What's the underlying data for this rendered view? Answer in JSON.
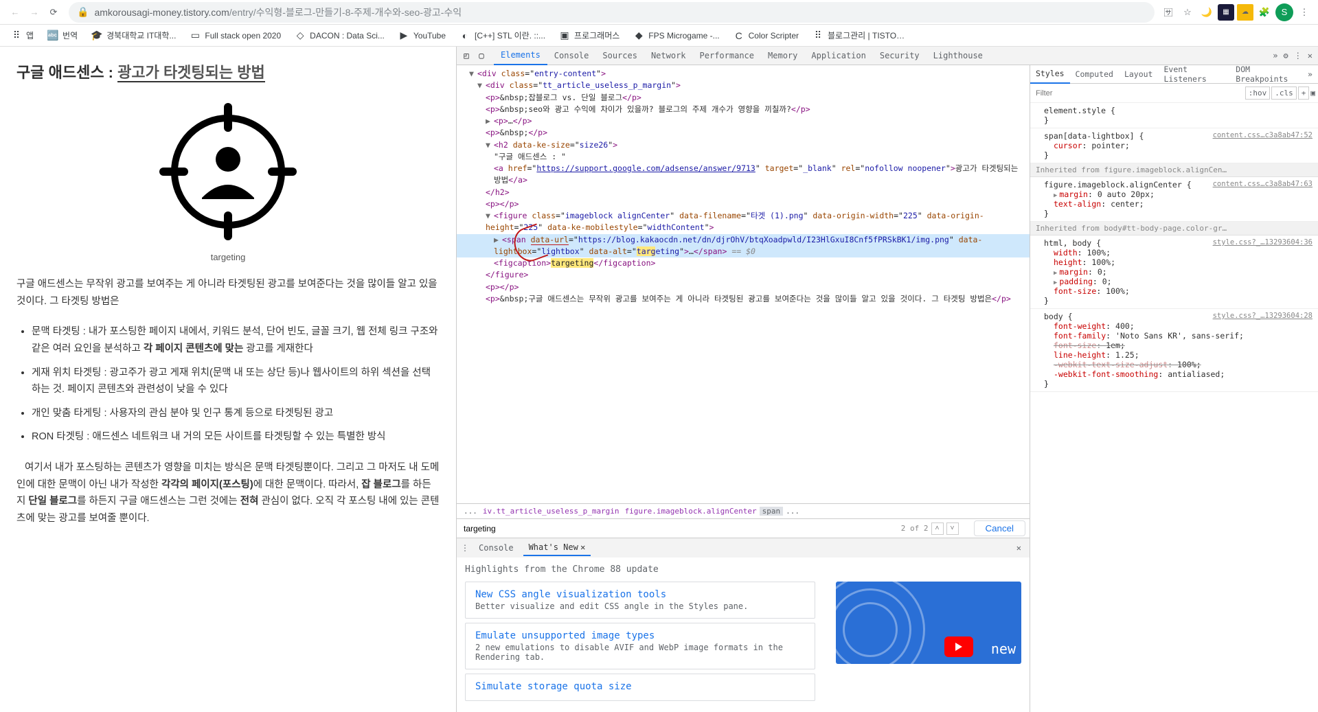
{
  "browser": {
    "url_domain": "amkorousagi-money.tistory.com",
    "url_path": "/entry/수익형-블로그-만들기-8-주제-개수와-seo-광고-수익",
    "actions": {
      "translate": "번역",
      "star": "즐겨찾기"
    },
    "avatar_letter": "S"
  },
  "bookmarks": [
    {
      "label": "앱",
      "icon": "⠿"
    },
    {
      "label": "번역",
      "icon": "🔤"
    },
    {
      "label": "경북대학교 IT대학...",
      "icon": "🎓"
    },
    {
      "label": "Full stack open 2020",
      "icon": "▭"
    },
    {
      "label": "DACON : Data Sci...",
      "icon": "◇"
    },
    {
      "label": "YouTube",
      "icon": "▶"
    },
    {
      "label": "[C++] STL 이란. ::...",
      "icon": "◐"
    },
    {
      "label": "프로그래머스",
      "icon": "▣"
    },
    {
      "label": "FPS Microgame -...",
      "icon": "◆"
    },
    {
      "label": "Color Scripter",
      "icon": "C"
    },
    {
      "label": "블로그관리 | TISTO…",
      "icon": "⠿"
    }
  ],
  "page": {
    "heading_prefix": "구글 애드센스 : ",
    "heading_link": "광고가 타겟팅되는 방법",
    "caption": "targeting",
    "intro": "구글 애드센스는 무작위 광고를 보여주는 게 아니라 타겟팅된 광고를 보여준다는 것을 많이들 알고 있을 것이다. 그 타겟팅 방법은",
    "bullets": [
      {
        "pre": "문맥 타겟팅 : 내가 포스팅한 페이지 내에서, 키워드 분석, 단어 빈도, 글꼴 크기, 웹 전체 링크 구조와 같은 여러 요인을 분석하고 ",
        "bold": "각 페이지 콘텐츠에 맞는",
        "post": " 광고를 게재한다"
      },
      {
        "pre": "게재 위치 타겟팅 : 광고주가 광고 게재 위치(문맥 내 또는 상단 등)나 웹사이트의 하위 섹션을 선택하는 것. 페이지 콘텐츠와 관련성이 낮을 수 있다",
        "bold": "",
        "post": ""
      },
      {
        "pre": "개인 맞춤 타게팅 : 사용자의 관심 분야 및 인구 통계 등으로 타겟팅된 광고",
        "bold": "",
        "post": ""
      },
      {
        "pre": "RON 타겟팅 : 애드센스 네트워크 내 거의 모든 사이트를 타겟팅할 수 있는 특별한 방식",
        "bold": "",
        "post": ""
      }
    ],
    "para2_pre": "여기서 내가 포스팅하는 콘텐츠가 영향을 미치는 방식은 문맥 타겟팅뿐이다. 그리고 그 마저도 내 도메인에 대한 문맥이 아닌 내가 작성한 ",
    "para2_b1": "각각의 페이지(포스팅)",
    "para2_mid": "에 대한 문맥이다. 따라서, ",
    "para2_b2": "잡 블로그",
    "para2_mid2": "를 하든지 ",
    "para2_b3": "단일 블로그",
    "para2_mid3": "를 하든지 구글 애드센스는 그런 것에는 ",
    "para2_b4": "전혀",
    "para2_end": " 관심이 없다. 오직 각 포스팅 내에 있는 콘텐츠에 맞는 광고를 보여줄 뿐이다."
  },
  "devtools": {
    "tabs": [
      "Elements",
      "Console",
      "Sources",
      "Network",
      "Performance",
      "Memory",
      "Application",
      "Security",
      "Lighthouse"
    ],
    "active_tab": "Elements",
    "breadcrumb": [
      "...",
      "iv.tt_article_useless_p_margin",
      "figure.imageblock.alignCenter",
      "span",
      "..."
    ],
    "search": {
      "value": "targeting",
      "count": "2 of 2",
      "cancel": "Cancel"
    },
    "dom": {
      "l1": "entry-content",
      "l2": "tt_article_useless_p_margin",
      "p1": "&nbsp;잡블로그 vs. 단일 블로그",
      "p2": "&nbsp;seo와 광고 수익에 차이가 있을까? 블로그의 주제 개수가 영향을 끼칠까?",
      "p3": "&nbsp;",
      "h2_attr": "size26",
      "h2_text": "\"구글 애드센스 : \"",
      "a_href": "https://support.google.com/adsense/answer/9713",
      "a_target": "_blank",
      "a_rel": "nofollow noopener",
      "a_text": "광고가 타겟팅되는 방법",
      "fig_class": "imageblock alignCenter",
      "fig_filename": "타겟 (1).png",
      "fig_ow": "225",
      "fig_oh": "225",
      "fig_mobile": "widthContent",
      "span_url": "https://blog.kakaocdn.net/dn/djrOhV/btqXoadpwld/I23HlGxuI8Cnf5fPRSkBK1/img.png",
      "span_lightbox": "lightbox",
      "span_alt": "targeting",
      "figcap": "targeting",
      "p_long": "&nbsp;구글 애드센스는 무작위 광고를 보여주는 게 아니라 타겟팅된 광고를 보여준다는 것을 많이들 알고 있을 것이다. 그 타겟팅 방법은"
    },
    "drawer": {
      "tabs": [
        "Console",
        "What's New"
      ],
      "active": "What's New",
      "heading": "Highlights from the Chrome 88 update",
      "items": [
        {
          "title": "New CSS angle visualization tools",
          "desc": "Better visualize and edit CSS angle in the Styles pane."
        },
        {
          "title": "Emulate unsupported image types",
          "desc": "2 new emulations to disable AVIF and WebP image formats in the Rendering tab."
        },
        {
          "title": "Simulate storage quota size",
          "desc": ""
        }
      ],
      "promo_text": "new"
    }
  },
  "styles": {
    "tabs": [
      "Styles",
      "Computed",
      "Layout",
      "Event Listeners",
      "DOM Breakpoints"
    ],
    "active": "Styles",
    "filter_placeholder": "Filter",
    "hov": ":hov",
    "cls": ".cls",
    "rules": [
      {
        "selector": "element.style",
        "source": "",
        "props": []
      },
      {
        "selector": "span[data-lightbox]",
        "source": "content.css…c3a8ab47:52",
        "props": [
          {
            "name": "cursor",
            "val": "pointer;"
          }
        ]
      },
      {
        "inherit": "figure.imageblock.alignCen…"
      },
      {
        "selector": "figure.imageblock.alignCenter",
        "source": "content.css…c3a8ab47:63",
        "props": [
          {
            "name": "margin",
            "val": "0 auto 20px;",
            "tri": true
          },
          {
            "name": "text-align",
            "val": "center;"
          }
        ]
      },
      {
        "inherit": "body#tt-body-page.color-gr…"
      },
      {
        "selector": "html, body",
        "source": "style.css?_…13293604:36",
        "props": [
          {
            "name": "width",
            "val": "100%;"
          },
          {
            "name": "height",
            "val": "100%;"
          },
          {
            "name": "margin",
            "val": "0;",
            "tri": true
          },
          {
            "name": "padding",
            "val": "0;",
            "tri": true
          },
          {
            "name": "font-size",
            "val": "100%;"
          }
        ]
      },
      {
        "selector": "body",
        "source": "style.css?_…13293604:28",
        "props": [
          {
            "name": "font-weight",
            "val": "400;"
          },
          {
            "name": "font-family",
            "val": "'Noto Sans KR', sans-serif;"
          },
          {
            "name": "font-size",
            "val": "1em;",
            "strike": true
          },
          {
            "name": "line-height",
            "val": "1.25;"
          },
          {
            "name": "-webkit-text-size-adjust",
            "val": "100%;",
            "strike": true
          },
          {
            "name": "-webkit-font-smoothing",
            "val": "antialiased;"
          }
        ]
      }
    ]
  }
}
